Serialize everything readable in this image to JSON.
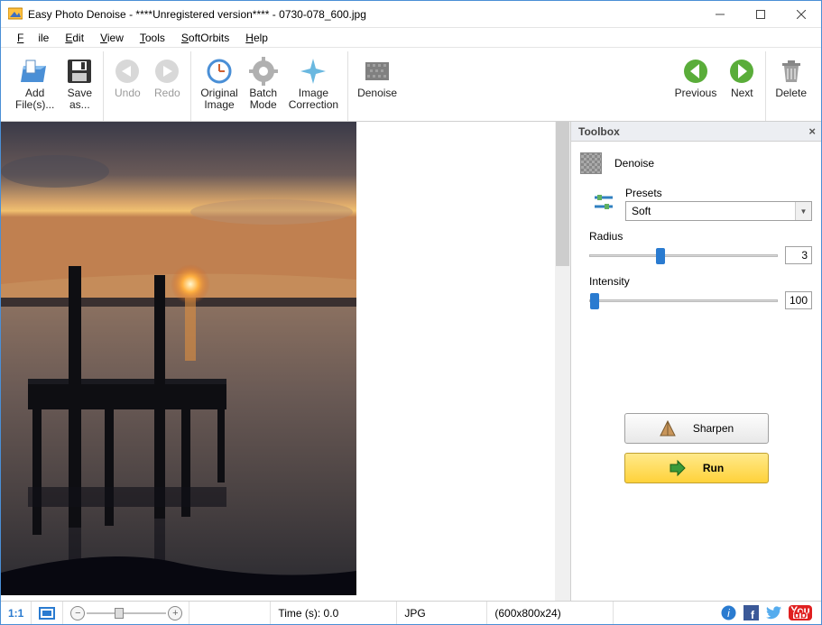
{
  "window": {
    "title": "Easy Photo Denoise - ****Unregistered version**** - 0730-078_600.jpg"
  },
  "menu": {
    "file": "File",
    "edit": "Edit",
    "view": "View",
    "tools": "Tools",
    "softorbits": "SoftOrbits",
    "help": "Help"
  },
  "toolbar": {
    "add_files": "Add\nFile(s)...",
    "save_as": "Save\nas...",
    "undo": "Undo",
    "redo": "Redo",
    "original_image": "Original\nImage",
    "batch_mode": "Batch\nMode",
    "image_correction": "Image\nCorrection",
    "denoise": "Denoise",
    "previous": "Previous",
    "next": "Next",
    "delete": "Delete"
  },
  "toolbox": {
    "title": "Toolbox",
    "denoise_label": "Denoise",
    "presets_label": "Presets",
    "preset_value": "Soft",
    "radius_label": "Radius",
    "radius_value": "3",
    "radius_pct": 38,
    "intensity_label": "Intensity",
    "intensity_value": "100",
    "intensity_pct": 3,
    "sharpen": "Sharpen",
    "run": "Run"
  },
  "status": {
    "zoom11": "1:1",
    "time": "Time (s): 0.0",
    "format": "JPG",
    "dims": "(600x800x24)"
  }
}
